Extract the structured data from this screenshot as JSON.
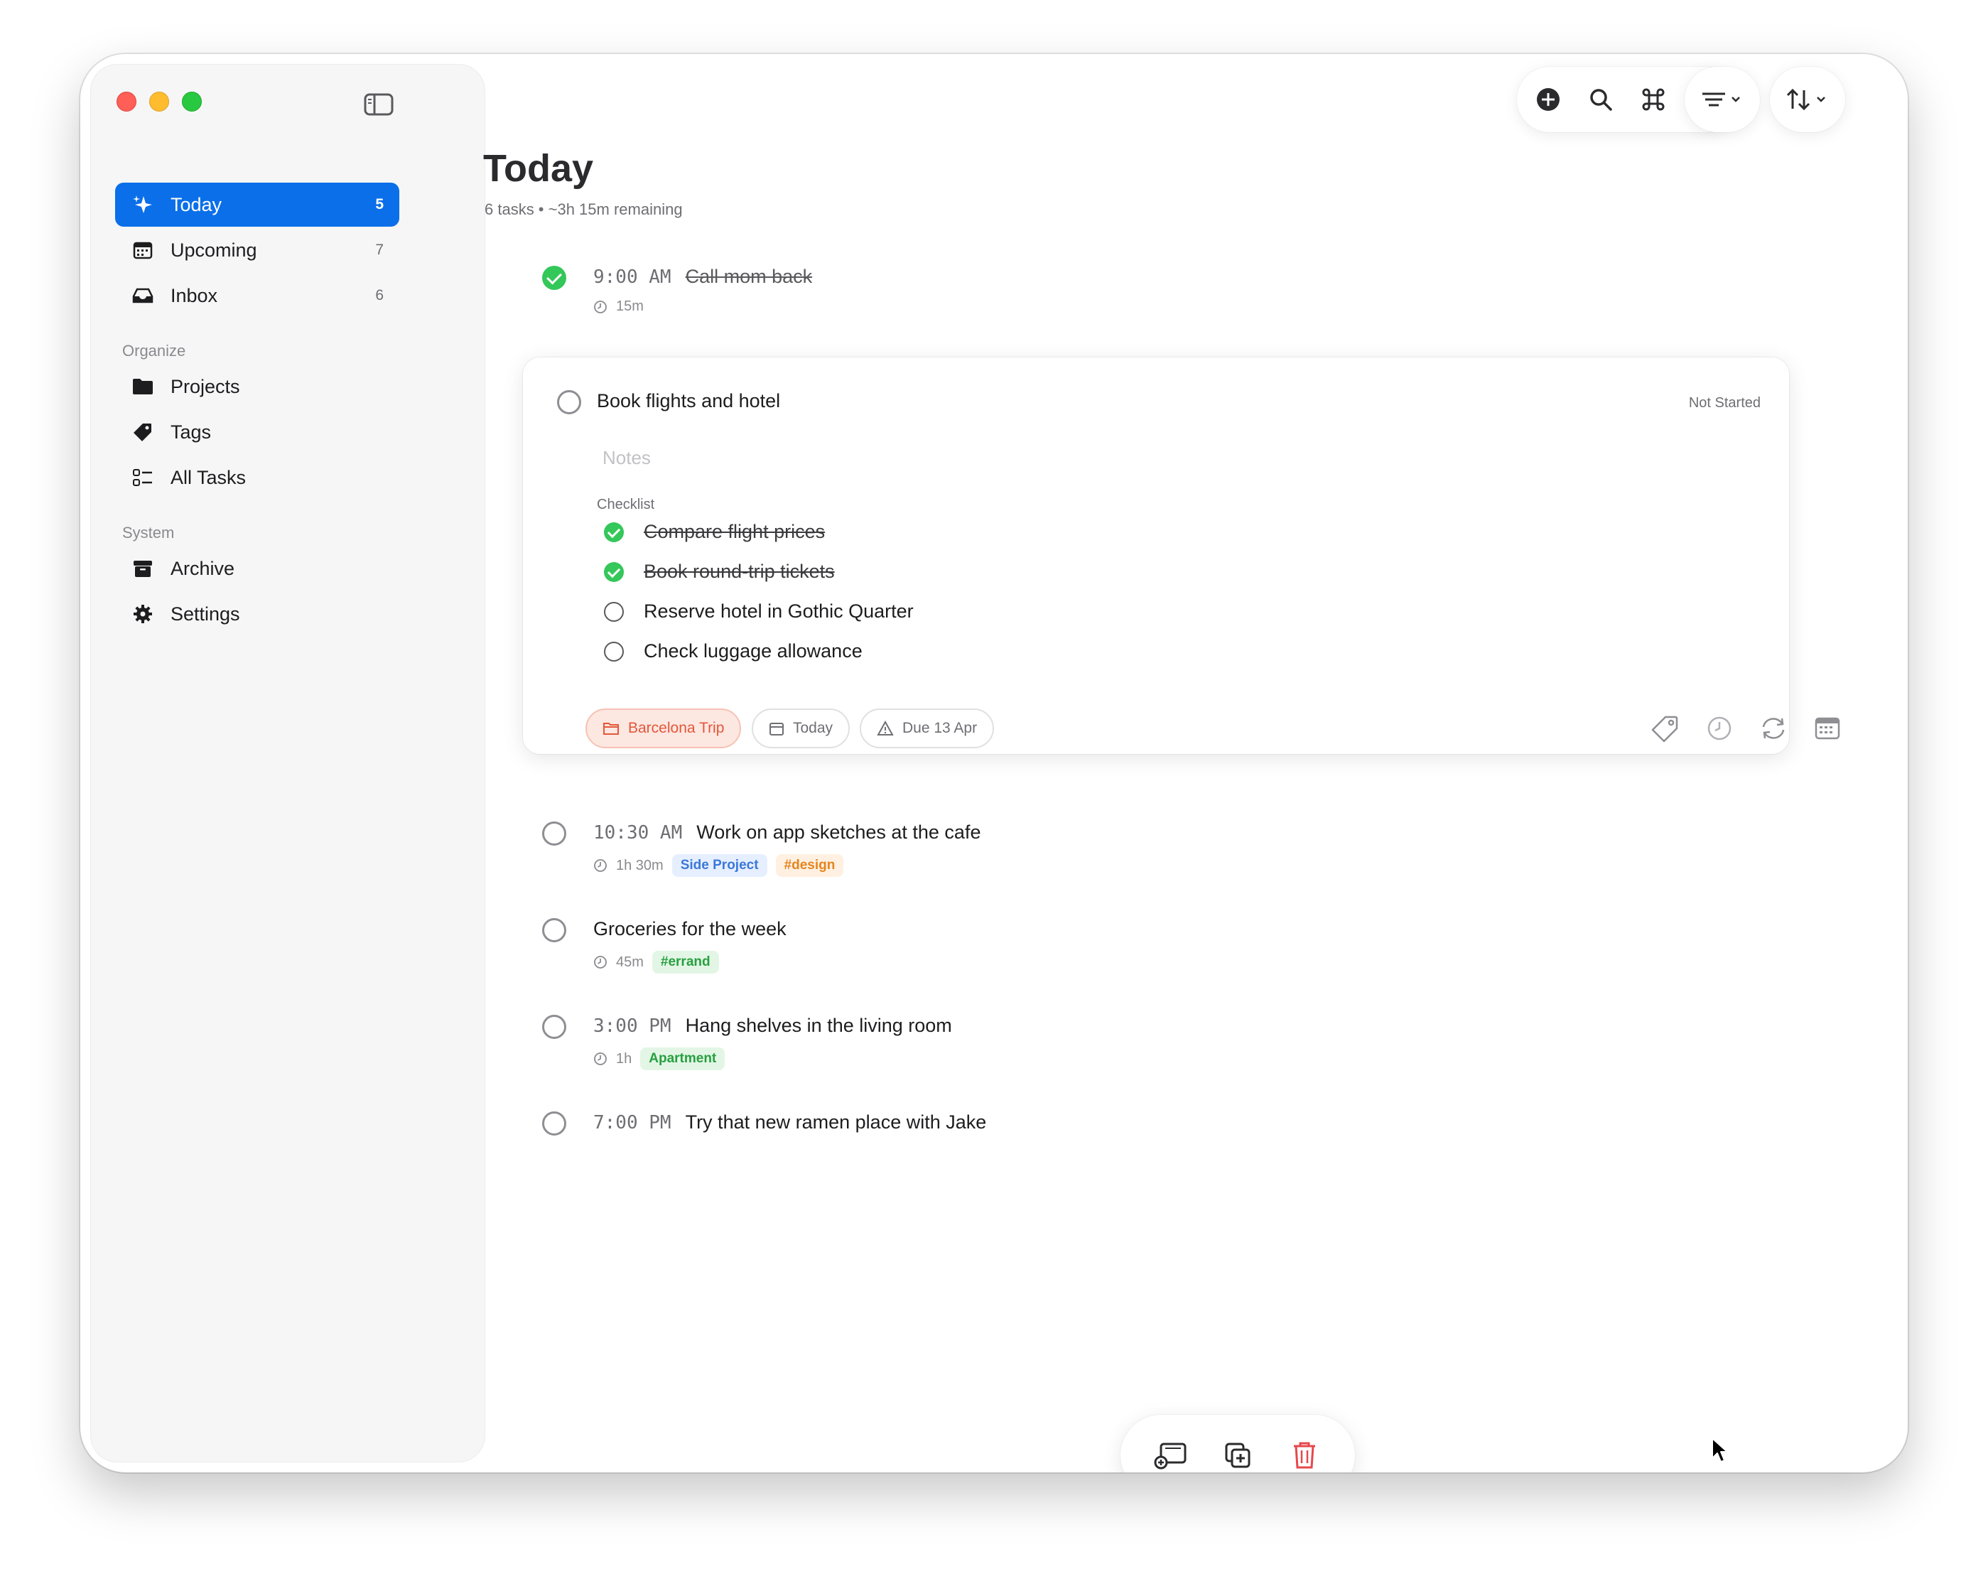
{
  "sidebar": {
    "items": [
      {
        "label": "Today",
        "count": "5",
        "icon": "sparkle-star-icon",
        "active": true
      },
      {
        "label": "Upcoming",
        "count": "7",
        "icon": "calendar-icon"
      },
      {
        "label": "Inbox",
        "count": "6",
        "icon": "inbox-tray-icon"
      }
    ],
    "organize_label": "Organize",
    "organize": [
      {
        "label": "Projects",
        "icon": "folder-icon"
      },
      {
        "label": "Tags",
        "icon": "tag-icon"
      },
      {
        "label": "All Tasks",
        "icon": "list-icon"
      }
    ],
    "system_label": "System",
    "system": [
      {
        "label": "Archive",
        "icon": "archive-box-icon"
      },
      {
        "label": "Settings",
        "icon": "gear-icon"
      }
    ]
  },
  "toolbar": {
    "buttons": [
      "add-circle-icon",
      "search-icon",
      "command-icon",
      "windows-icon"
    ],
    "filter_icon": "filter-lines-icon",
    "sort_icon": "sort-arrows-icon"
  },
  "page": {
    "title": "Today",
    "subtitle": "6 tasks • ~3h 15m remaining"
  },
  "tasks": [
    {
      "time": "9:00 AM",
      "title": "Call mom back",
      "done": true,
      "duration": "15m"
    },
    {
      "title": "Book flights and hotel",
      "status": "Not Started",
      "notes_placeholder": "Notes",
      "checklist_label": "Checklist",
      "checklist": [
        {
          "text": "Compare flight prices",
          "done": true
        },
        {
          "text": "Book round-trip tickets",
          "done": true
        },
        {
          "text": "Reserve hotel in Gothic Quarter",
          "done": false
        },
        {
          "text": "Check luggage allowance",
          "done": false
        }
      ],
      "chips": {
        "project": "Barcelona Trip",
        "when": "Today",
        "due": "Due 13 Apr"
      },
      "actions": [
        "tag-icon",
        "clock-icon",
        "repeat-icon",
        "calendar-icon"
      ]
    },
    {
      "time": "10:30 AM",
      "title": "Work on app sketches at the cafe",
      "duration": "1h 30m",
      "tags": [
        "Side Project",
        "#design"
      ]
    },
    {
      "title": "Groceries for the week",
      "duration": "45m",
      "tags": [
        "#errand"
      ]
    },
    {
      "time": "3:00 PM",
      "title": "Hang shelves in the living room",
      "duration": "1h",
      "tags": [
        "Apartment"
      ]
    },
    {
      "time": "7:00 PM",
      "title": "Try that new ramen place with Jake"
    }
  ],
  "bottom_bar": [
    "move-to-icon",
    "duplicate-icon",
    "trash-icon"
  ],
  "colors": {
    "accent": "#0a6fe8",
    "done_green": "#34c759",
    "delete_red": "#e5484d",
    "project_chip": "#e2573a"
  }
}
